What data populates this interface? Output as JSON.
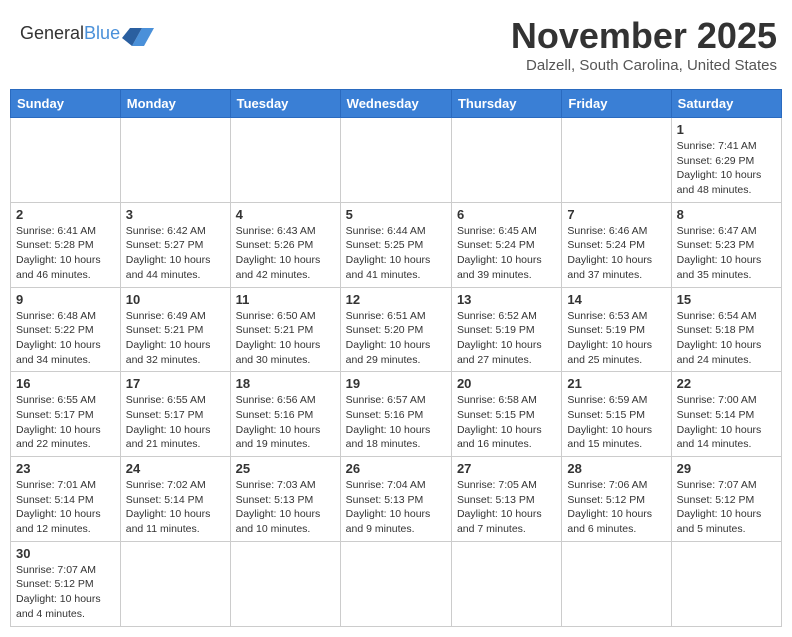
{
  "logo": {
    "text_general": "General",
    "text_blue": "Blue"
  },
  "title": "November 2025",
  "subtitle": "Dalzell, South Carolina, United States",
  "days_of_week": [
    "Sunday",
    "Monday",
    "Tuesday",
    "Wednesday",
    "Thursday",
    "Friday",
    "Saturday"
  ],
  "weeks": [
    [
      {
        "day": "",
        "info": ""
      },
      {
        "day": "",
        "info": ""
      },
      {
        "day": "",
        "info": ""
      },
      {
        "day": "",
        "info": ""
      },
      {
        "day": "",
        "info": ""
      },
      {
        "day": "",
        "info": ""
      },
      {
        "day": "1",
        "info": "Sunrise: 7:41 AM\nSunset: 6:29 PM\nDaylight: 10 hours\nand 48 minutes."
      }
    ],
    [
      {
        "day": "2",
        "info": "Sunrise: 6:41 AM\nSunset: 5:28 PM\nDaylight: 10 hours\nand 46 minutes."
      },
      {
        "day": "3",
        "info": "Sunrise: 6:42 AM\nSunset: 5:27 PM\nDaylight: 10 hours\nand 44 minutes."
      },
      {
        "day": "4",
        "info": "Sunrise: 6:43 AM\nSunset: 5:26 PM\nDaylight: 10 hours\nand 42 minutes."
      },
      {
        "day": "5",
        "info": "Sunrise: 6:44 AM\nSunset: 5:25 PM\nDaylight: 10 hours\nand 41 minutes."
      },
      {
        "day": "6",
        "info": "Sunrise: 6:45 AM\nSunset: 5:24 PM\nDaylight: 10 hours\nand 39 minutes."
      },
      {
        "day": "7",
        "info": "Sunrise: 6:46 AM\nSunset: 5:24 PM\nDaylight: 10 hours\nand 37 minutes."
      },
      {
        "day": "8",
        "info": "Sunrise: 6:47 AM\nSunset: 5:23 PM\nDaylight: 10 hours\nand 35 minutes."
      }
    ],
    [
      {
        "day": "9",
        "info": "Sunrise: 6:48 AM\nSunset: 5:22 PM\nDaylight: 10 hours\nand 34 minutes."
      },
      {
        "day": "10",
        "info": "Sunrise: 6:49 AM\nSunset: 5:21 PM\nDaylight: 10 hours\nand 32 minutes."
      },
      {
        "day": "11",
        "info": "Sunrise: 6:50 AM\nSunset: 5:21 PM\nDaylight: 10 hours\nand 30 minutes."
      },
      {
        "day": "12",
        "info": "Sunrise: 6:51 AM\nSunset: 5:20 PM\nDaylight: 10 hours\nand 29 minutes."
      },
      {
        "day": "13",
        "info": "Sunrise: 6:52 AM\nSunset: 5:19 PM\nDaylight: 10 hours\nand 27 minutes."
      },
      {
        "day": "14",
        "info": "Sunrise: 6:53 AM\nSunset: 5:19 PM\nDaylight: 10 hours\nand 25 minutes."
      },
      {
        "day": "15",
        "info": "Sunrise: 6:54 AM\nSunset: 5:18 PM\nDaylight: 10 hours\nand 24 minutes."
      }
    ],
    [
      {
        "day": "16",
        "info": "Sunrise: 6:55 AM\nSunset: 5:17 PM\nDaylight: 10 hours\nand 22 minutes."
      },
      {
        "day": "17",
        "info": "Sunrise: 6:55 AM\nSunset: 5:17 PM\nDaylight: 10 hours\nand 21 minutes."
      },
      {
        "day": "18",
        "info": "Sunrise: 6:56 AM\nSunset: 5:16 PM\nDaylight: 10 hours\nand 19 minutes."
      },
      {
        "day": "19",
        "info": "Sunrise: 6:57 AM\nSunset: 5:16 PM\nDaylight: 10 hours\nand 18 minutes."
      },
      {
        "day": "20",
        "info": "Sunrise: 6:58 AM\nSunset: 5:15 PM\nDaylight: 10 hours\nand 16 minutes."
      },
      {
        "day": "21",
        "info": "Sunrise: 6:59 AM\nSunset: 5:15 PM\nDaylight: 10 hours\nand 15 minutes."
      },
      {
        "day": "22",
        "info": "Sunrise: 7:00 AM\nSunset: 5:14 PM\nDaylight: 10 hours\nand 14 minutes."
      }
    ],
    [
      {
        "day": "23",
        "info": "Sunrise: 7:01 AM\nSunset: 5:14 PM\nDaylight: 10 hours\nand 12 minutes."
      },
      {
        "day": "24",
        "info": "Sunrise: 7:02 AM\nSunset: 5:14 PM\nDaylight: 10 hours\nand 11 minutes."
      },
      {
        "day": "25",
        "info": "Sunrise: 7:03 AM\nSunset: 5:13 PM\nDaylight: 10 hours\nand 10 minutes."
      },
      {
        "day": "26",
        "info": "Sunrise: 7:04 AM\nSunset: 5:13 PM\nDaylight: 10 hours\nand 9 minutes."
      },
      {
        "day": "27",
        "info": "Sunrise: 7:05 AM\nSunset: 5:13 PM\nDaylight: 10 hours\nand 7 minutes."
      },
      {
        "day": "28",
        "info": "Sunrise: 7:06 AM\nSunset: 5:12 PM\nDaylight: 10 hours\nand 6 minutes."
      },
      {
        "day": "29",
        "info": "Sunrise: 7:07 AM\nSunset: 5:12 PM\nDaylight: 10 hours\nand 5 minutes."
      }
    ],
    [
      {
        "day": "30",
        "info": "Sunrise: 7:07 AM\nSunset: 5:12 PM\nDaylight: 10 hours\nand 4 minutes."
      },
      {
        "day": "",
        "info": ""
      },
      {
        "day": "",
        "info": ""
      },
      {
        "day": "",
        "info": ""
      },
      {
        "day": "",
        "info": ""
      },
      {
        "day": "",
        "info": ""
      },
      {
        "day": "",
        "info": ""
      }
    ]
  ]
}
